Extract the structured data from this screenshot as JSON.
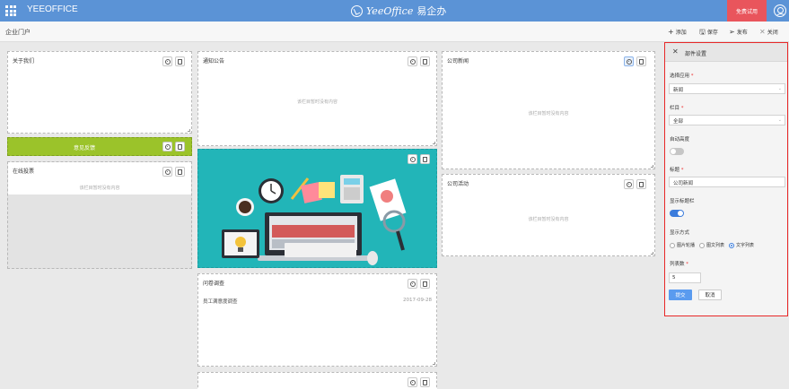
{
  "header": {
    "brand": "YEEOFFICE",
    "logo_en": "YeeOffice",
    "logo_cn": "易企办",
    "trial_label": "免费试用",
    "icons": [
      "apps-grid-icon",
      "logo-icon",
      "user-avatar-icon"
    ]
  },
  "subbar": {
    "title": "企业门户",
    "add_label": "添加",
    "save_label": "保存",
    "publish_label": "发布",
    "close_label": "关闭"
  },
  "widgets": {
    "about": {
      "title": "关于我们"
    },
    "notice": {
      "title": "通知公告",
      "empty": "该栏目暂时没有内容"
    },
    "company_news": {
      "title": "公司新闻",
      "empty": "该栏目暂时没有内容"
    },
    "feedback": {
      "label": "意见反馈",
      "accent": "#9bc32a"
    },
    "online_vote": {
      "title": "在线投票",
      "empty": "该栏目暂时没有内容"
    },
    "company_events": {
      "title": "公司活动",
      "empty": "该栏目暂时没有内容"
    },
    "survey": {
      "title": "问卷调查",
      "rows": [
        {
          "name": "员工满意度调查",
          "date": "2017-09-28"
        }
      ]
    }
  },
  "panel": {
    "title": "部件设置",
    "app_label": "选择应用",
    "app_value": "新闻",
    "column_label": "栏目",
    "column_value": "全部",
    "auto_height_label": "自动高度",
    "auto_height_on": false,
    "title_label": "标题",
    "title_value": "公司新闻",
    "show_title_bar_label": "显示标题栏",
    "show_title_bar_on": true,
    "display_mode_label": "显示方式",
    "display_modes": [
      "图片轮播",
      "图文列表",
      "文字列表"
    ],
    "display_mode_selected": "文字列表",
    "count_label": "列表数",
    "count_value": "5",
    "submit_label": "提交",
    "cancel_label": "取消",
    "border_color": "#e82828",
    "primary_color": "#5a9bef"
  },
  "colors": {
    "topbar": "#5b93d6",
    "trial": "#e9555c",
    "toggle_on": "#3b7cdc"
  }
}
